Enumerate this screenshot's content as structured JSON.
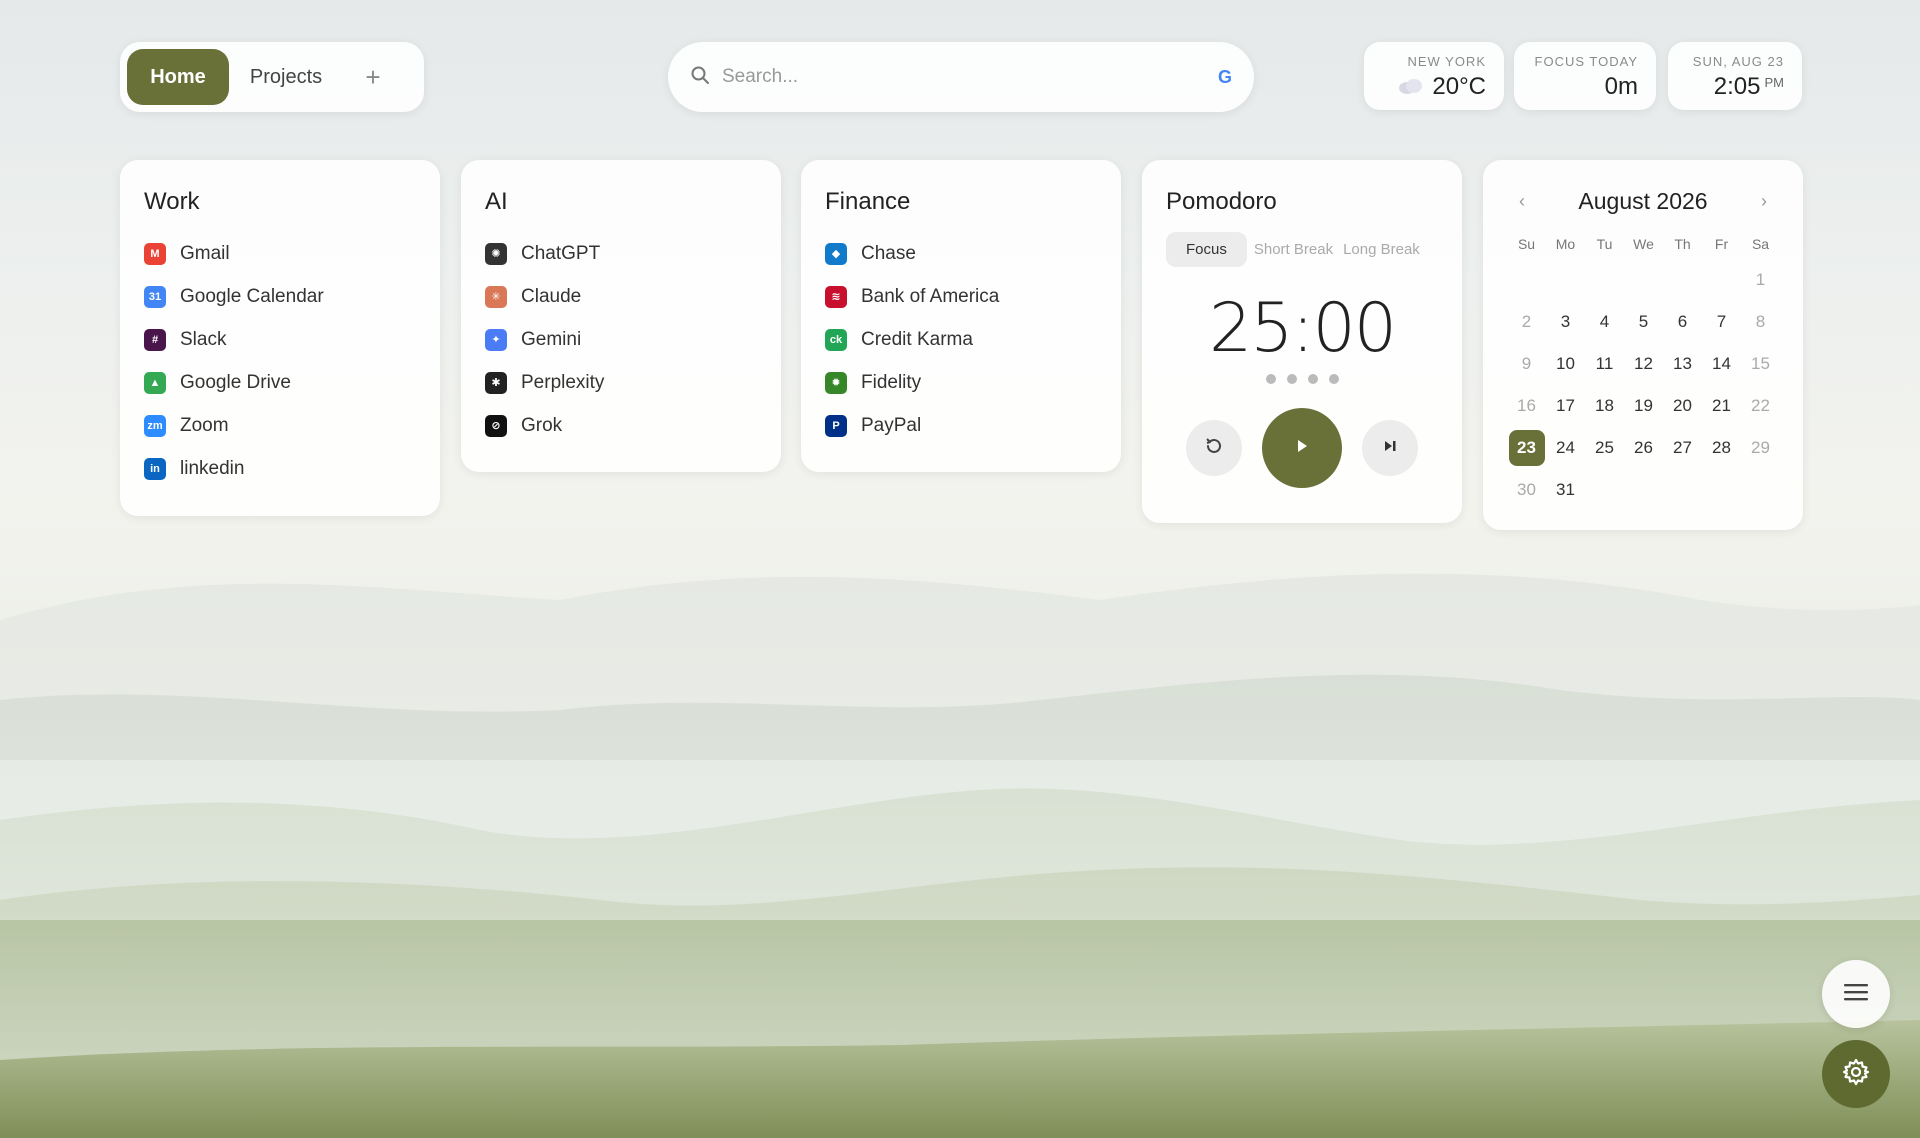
{
  "nav": {
    "tabs": [
      {
        "label": "Home",
        "active": true
      },
      {
        "label": "Projects",
        "active": false
      }
    ],
    "add_label": "+"
  },
  "search": {
    "placeholder": "Search...",
    "engine_icon": "google-icon",
    "engine_glyph": "G"
  },
  "weather": {
    "label": "NEW YORK",
    "value": "20°C",
    "icon": "cloud-icon"
  },
  "focus": {
    "label": "FOCUS TODAY",
    "value": "0m"
  },
  "clock": {
    "label": "SUN, AUG 23",
    "time": "2:05",
    "ampm": "PM"
  },
  "work": {
    "title": "Work",
    "links": [
      {
        "label": "Gmail",
        "icon": "gmail-icon",
        "color": "#ea4335",
        "glyph": "M"
      },
      {
        "label": "Google Calendar",
        "icon": "google-calendar-icon",
        "color": "#4285f4",
        "glyph": "31"
      },
      {
        "label": "Slack",
        "icon": "slack-icon",
        "color": "#4a154b",
        "glyph": "#"
      },
      {
        "label": "Google Drive",
        "icon": "google-drive-icon",
        "color": "#34a853",
        "glyph": "▲"
      },
      {
        "label": "Zoom",
        "icon": "zoom-icon",
        "color": "#2d8cff",
        "glyph": "zm"
      },
      {
        "label": "linkedin",
        "icon": "linkedin-icon",
        "color": "#0a66c2",
        "glyph": "in"
      }
    ]
  },
  "ai": {
    "title": "AI",
    "links": [
      {
        "label": "ChatGPT",
        "icon": "chatgpt-icon",
        "color": "#333333",
        "glyph": "✺"
      },
      {
        "label": "Claude",
        "icon": "claude-icon",
        "color": "#d97757",
        "glyph": "✳"
      },
      {
        "label": "Gemini",
        "icon": "gemini-icon",
        "color": "#4a7cf6",
        "glyph": "✦"
      },
      {
        "label": "Perplexity",
        "icon": "perplexity-icon",
        "color": "#222222",
        "glyph": "✱"
      },
      {
        "label": "Grok",
        "icon": "grok-icon",
        "color": "#111111",
        "glyph": "⊘"
      }
    ]
  },
  "finance": {
    "title": "Finance",
    "links": [
      {
        "label": "Chase",
        "icon": "chase-icon",
        "color": "#117aca",
        "glyph": "◆"
      },
      {
        "label": "Bank of America",
        "icon": "bank-of-america-icon",
        "color": "#c8102e",
        "glyph": "≋"
      },
      {
        "label": "Credit Karma",
        "icon": "credit-karma-icon",
        "color": "#21a656",
        "glyph": "ck"
      },
      {
        "label": "Fidelity",
        "icon": "fidelity-icon",
        "color": "#368727",
        "glyph": "✹"
      },
      {
        "label": "PayPal",
        "icon": "paypal-icon",
        "color": "#003087",
        "glyph": "P"
      }
    ]
  },
  "pomodoro": {
    "title": "Pomodoro",
    "modes": [
      "Focus",
      "Short Break",
      "Long Break"
    ],
    "active_mode": "Focus",
    "time": "25:00",
    "sessions": 4
  },
  "calendar": {
    "title": "August 2026",
    "weekdays": [
      "Su",
      "Mo",
      "Tu",
      "We",
      "Th",
      "Fr",
      "Sa"
    ],
    "first_weekday": 6,
    "days_in_month": 31,
    "today": 23
  },
  "colors": {
    "accent": "#6a7138",
    "gear_bg": "#5e6a30"
  }
}
